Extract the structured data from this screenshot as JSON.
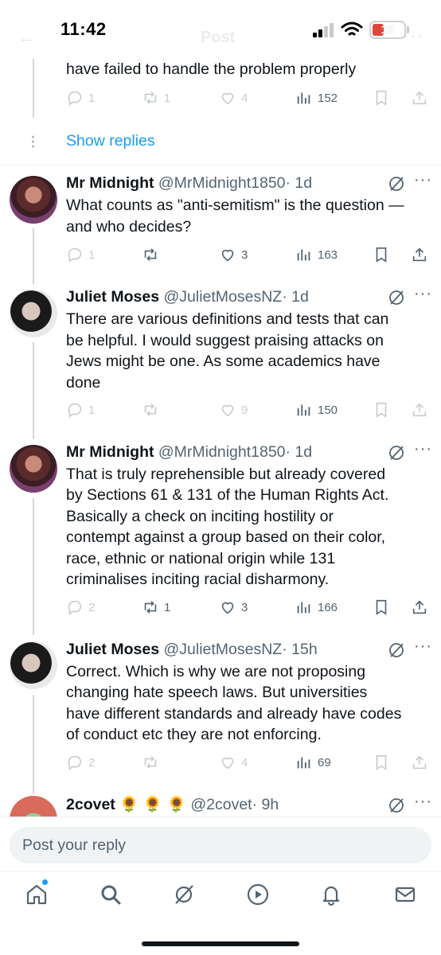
{
  "status_bar": {
    "time": "11:42",
    "battery": "10"
  },
  "header": {
    "title": "Post"
  },
  "prev_tweet": {
    "text_tail": "have failed to handle the problem properly",
    "replies": "1",
    "reposts": "1",
    "likes": "4",
    "views": "152"
  },
  "show_replies": "Show replies",
  "tweets": [
    {
      "name": "Mr Midnight",
      "handle": "@MrMidnight1850",
      "time": "· 1d",
      "lines": [
        "What counts as \"anti-semitism\" is the question —",
        "and who decides?"
      ],
      "replies": "1",
      "reposts": "",
      "likes": "3",
      "views": "163"
    },
    {
      "name": "Juliet Moses",
      "handle": "@JulietMosesNZ",
      "time": "· 1d",
      "lines": [
        "There are various definitions and tests that can",
        "be  helpful. I would suggest praising attacks on",
        "Jews might be one. As some academics have",
        "done"
      ],
      "replies": "1",
      "reposts": "",
      "likes": "9",
      "views": "150"
    },
    {
      "name": "Mr Midnight",
      "handle": "@MrMidnight1850",
      "time": "· 1d",
      "lines": [
        "That is truly reprehensible but already covered",
        "by Sections 61 & 131 of the Human Rights Act.",
        "Basically a check on inciting hostility or",
        "contempt against a group based on their color,",
        "race, ethnic or national origin while 131",
        "criminalises inciting racial disharmony."
      ],
      "replies": "2",
      "reposts": "1",
      "likes": "3",
      "views": "166"
    },
    {
      "name": "Juliet Moses",
      "handle": "@JulietMosesNZ",
      "time": "· 15h",
      "lines": [
        "Correct. Which is why we are not proposing",
        "changing hate speech laws.  But universities",
        "have different standards and already have codes",
        "of conduct etc they are not enforcing."
      ],
      "replies": "2",
      "reposts": "",
      "likes": "4",
      "views": "69"
    },
    {
      "name": "2covet",
      "name_emoji": "🌻 🌻 🌻",
      "handle": "@2covet",
      "time": "· 9h"
    }
  ],
  "reply_bar": {
    "placeholder": "Post your reply"
  },
  "colors": {
    "accent": "#1d9bf0",
    "text": "#0f1419",
    "secondary": "#536471",
    "battery_low": "#e0443b"
  },
  "icons": [
    "reply-icon",
    "repost-icon",
    "like-icon",
    "views-icon",
    "bookmark-icon",
    "share-icon",
    "grok-icon",
    "more-icon",
    "home-icon",
    "search-icon",
    "grok-tab-icon",
    "video-icon",
    "notifications-icon",
    "messages-icon"
  ]
}
